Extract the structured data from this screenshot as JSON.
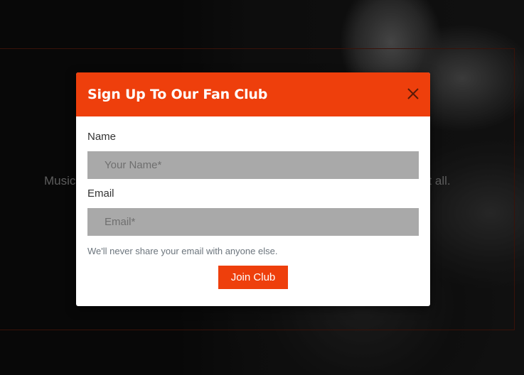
{
  "background": {
    "text_left": "Music",
    "text_right": "at all."
  },
  "modal": {
    "title": "Sign Up To Our Fan Club",
    "close_icon": "close-icon",
    "name_label": "Name",
    "name_placeholder": "Your Name*",
    "email_label": "Email",
    "email_placeholder": "Email*",
    "help_text": "We'll never share your email with anyone else.",
    "submit_label": "Join Club"
  },
  "colors": {
    "accent": "#ee3f0c",
    "input_bg": "#a9a9a9",
    "page_bg": "#0d0d0d"
  }
}
